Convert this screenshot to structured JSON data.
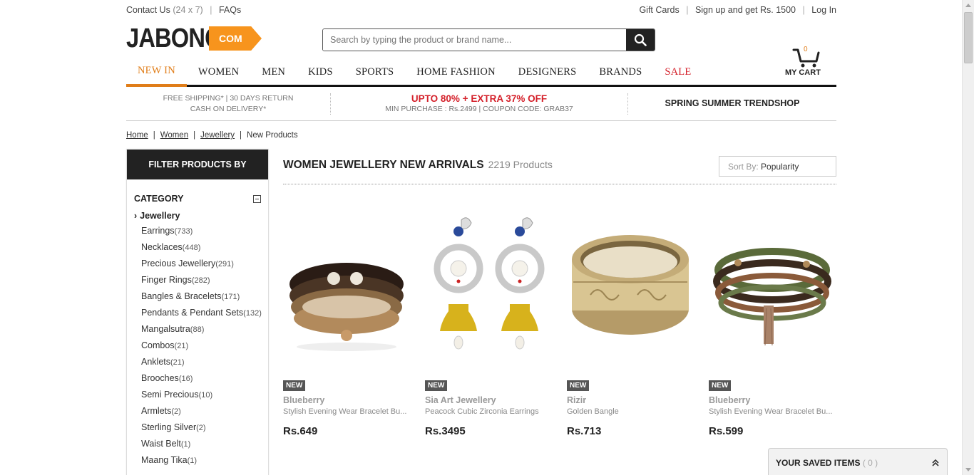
{
  "topbar": {
    "contact": "Contact Us",
    "contact_hours": "(24 x 7)",
    "faqs": "FAQs",
    "gift_cards": "Gift Cards",
    "signup": "Sign up and get Rs. 1500",
    "login": "Log In"
  },
  "header": {
    "logo_text": "JABONG",
    "logo_com": "COM",
    "search_placeholder": "Search by typing the product or brand name..."
  },
  "nav": {
    "items": [
      "NEW IN",
      "WOMEN",
      "MEN",
      "KIDS",
      "SPORTS",
      "HOME FASHION",
      "DESIGNERS",
      "BRANDS",
      "SALE"
    ],
    "active": "NEW IN",
    "cart_count": "0",
    "cart_label": "MY CART"
  },
  "promo": {
    "left_line1": "FREE SHIPPING* | 30 DAYS RETURN",
    "left_line2": "CASH ON DELIVERY*",
    "mid_line1": "UPTO 80% + EXTRA 37% OFF",
    "mid_line2": "MIN PURCHASE : Rs.2499 | COUPON CODE: GRAB37",
    "right": "SPRING SUMMER TRENDSHOP"
  },
  "breadcrumb": [
    "Home",
    "Women",
    "Jewellery",
    "New Products"
  ],
  "sidebar": {
    "header": "FILTER PRODUCTS BY",
    "category_label": "CATEGORY",
    "selected": "Jewellery",
    "items": [
      {
        "label": "Earrings",
        "count": "(733)"
      },
      {
        "label": "Necklaces",
        "count": "(448)"
      },
      {
        "label": "Precious Jewellery",
        "count": "(291)"
      },
      {
        "label": "Finger Rings",
        "count": "(282)"
      },
      {
        "label": "Bangles & Bracelets",
        "count": "(171)"
      },
      {
        "label": "Pendants & Pendant Sets",
        "count": "(132)"
      },
      {
        "label": "Mangalsutra",
        "count": "(88)"
      },
      {
        "label": "Combos",
        "count": "(21)"
      },
      {
        "label": "Anklets",
        "count": "(21)"
      },
      {
        "label": "Brooches",
        "count": "(16)"
      },
      {
        "label": "Semi Precious",
        "count": "(10)"
      },
      {
        "label": "Armlets",
        "count": "(2)"
      },
      {
        "label": "Sterling Silver",
        "count": "(2)"
      },
      {
        "label": "Waist Belt",
        "count": "(1)"
      },
      {
        "label": "Maang Tika",
        "count": "(1)"
      }
    ]
  },
  "main": {
    "title": "WOMEN JEWELLERY NEW ARRIVALS",
    "count": "2219 Products",
    "sort_label": "Sort By:",
    "sort_value": "Popularity"
  },
  "products": [
    {
      "badge": "NEW",
      "brand": "Blueberry",
      "desc": "Stylish Evening Wear Bracelet Bu...",
      "price": "Rs.649",
      "image": "bracelet-stack"
    },
    {
      "badge": "NEW",
      "brand": "Sia Art Jewellery",
      "desc": "Peacock Cubic Zirconia Earrings",
      "price": "Rs.3495",
      "image": "peacock-earrings"
    },
    {
      "badge": "NEW",
      "brand": "Rizir",
      "desc": "Golden Bangle",
      "price": "Rs.713",
      "image": "golden-bangle"
    },
    {
      "badge": "NEW",
      "brand": "Blueberry",
      "desc": "Stylish Evening Wear Bracelet Bu...",
      "price": "Rs.599",
      "image": "bead-bracelet"
    }
  ],
  "saved": {
    "label": "YOUR SAVED ITEMS",
    "count": "( 0 )"
  },
  "colors": {
    "accent": "#e07d18",
    "sale": "#d4202a",
    "logo_orange": "#f7941d",
    "dark": "#222222"
  }
}
